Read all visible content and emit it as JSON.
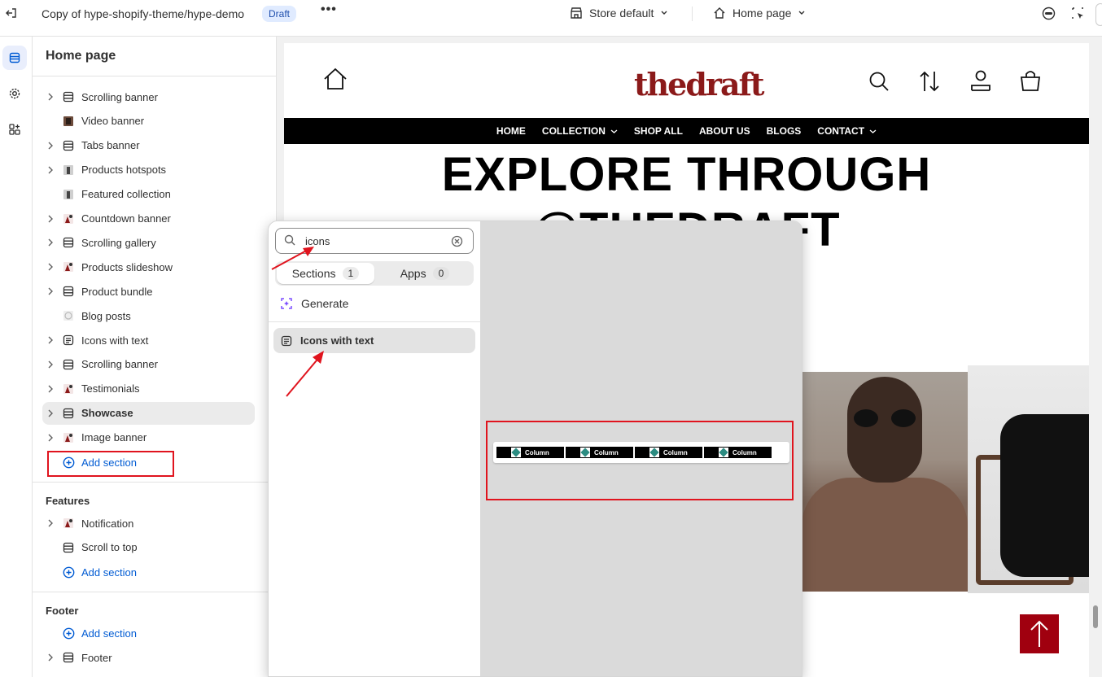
{
  "topbar": {
    "theme_title": "Copy of hype-shopify-theme/hype-demo",
    "status_badge": "Draft",
    "more": "•••",
    "store_selector": "Store default",
    "page_selector": "Home page"
  },
  "sidebar": {
    "title": "Home page",
    "template_items": [
      {
        "label": "Scrolling banner",
        "icon": "section-icon",
        "expandable": true
      },
      {
        "label": "Video banner",
        "icon": "video-thumb-icon",
        "expandable": false
      },
      {
        "label": "Tabs banner",
        "icon": "section-icon",
        "expandable": true
      },
      {
        "label": "Products hotspots",
        "icon": "product-thumb-icon",
        "expandable": true
      },
      {
        "label": "Featured collection",
        "icon": "product-thumb-icon",
        "expandable": false
      },
      {
        "label": "Countdown banner",
        "icon": "image-thumb-icon",
        "expandable": true
      },
      {
        "label": "Scrolling gallery",
        "icon": "section-icon",
        "expandable": true
      },
      {
        "label": "Products slideshow",
        "icon": "image-thumb-icon",
        "expandable": true
      },
      {
        "label": "Product bundle",
        "icon": "section-icon",
        "expandable": true
      },
      {
        "label": "Blog posts",
        "icon": "blog-thumb-icon",
        "expandable": false
      },
      {
        "label": "Icons with text",
        "icon": "text-block-icon",
        "expandable": true
      },
      {
        "label": "Scrolling banner",
        "icon": "section-icon",
        "expandable": true
      },
      {
        "label": "Testimonials",
        "icon": "image-thumb-icon",
        "expandable": true
      },
      {
        "label": "Showcase",
        "icon": "section-icon",
        "expandable": true
      },
      {
        "label": "Image banner",
        "icon": "image-thumb-icon",
        "expandable": true
      }
    ],
    "add_section_label": "Add section",
    "features_title": "Features",
    "features_items": [
      {
        "label": "Notification",
        "icon": "image-thumb-icon",
        "expandable": true
      },
      {
        "label": "Scroll to top",
        "icon": "section-icon",
        "expandable": false
      }
    ],
    "footer_title": "Footer",
    "footer_items": [
      {
        "label": "Footer",
        "icon": "section-icon",
        "expandable": true
      }
    ]
  },
  "preview": {
    "logo_text": "thedraft",
    "nav": [
      "HOME",
      "COLLECTION",
      "SHOP ALL",
      "ABOUT US",
      "BLOGS",
      "CONTACT"
    ],
    "hero_line1": "EXPLORE THROUGH",
    "hero_line2": "@THEDRAFT"
  },
  "popover": {
    "search_value": "icons",
    "tab_sections": "Sections",
    "tab_sections_count": "1",
    "tab_apps": "Apps",
    "tab_apps_count": "0",
    "generate_label": "Generate",
    "result_label": "Icons with text",
    "thumbnail_columns": [
      "Column",
      "Column",
      "Column",
      "Column"
    ]
  },
  "colors": {
    "accent_red": "#e0141e",
    "link_blue": "#005bd3",
    "brand_red": "#8b1a1a",
    "scroll_top_bg": "#a0000f"
  }
}
